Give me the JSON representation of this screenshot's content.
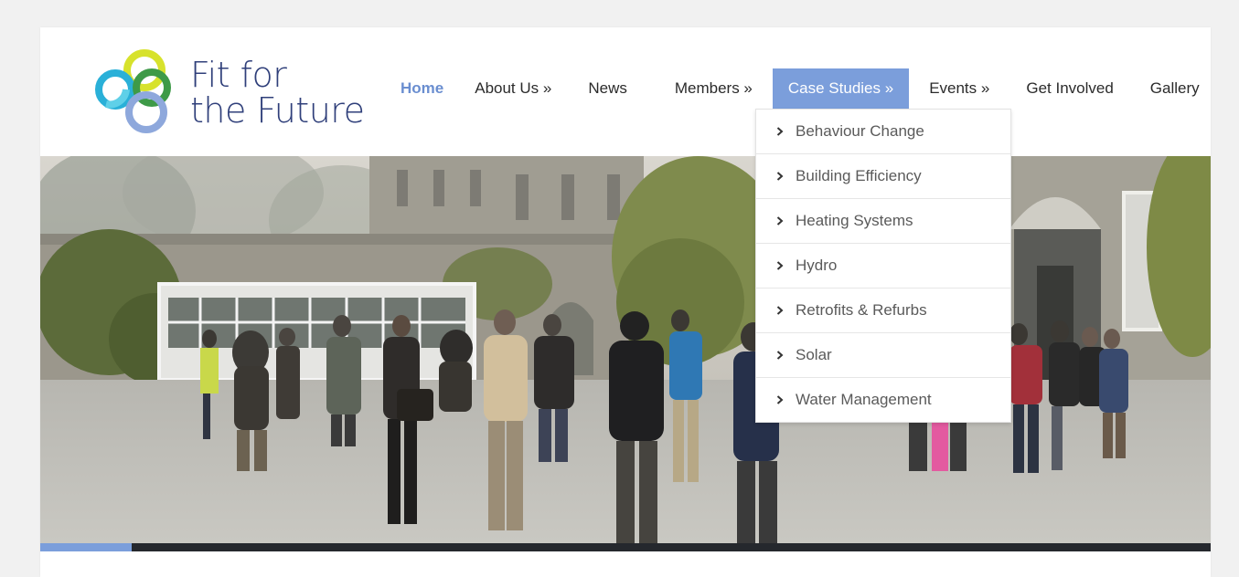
{
  "logo": {
    "line1": "Fit for",
    "line2": "the Future"
  },
  "nav": {
    "items": [
      {
        "label": "Home"
      },
      {
        "label": "About Us »"
      },
      {
        "label": "News"
      },
      {
        "label": "Members »"
      },
      {
        "label": "Case Studies »"
      },
      {
        "label": "Events »"
      },
      {
        "label": "Get Involved"
      },
      {
        "label": "Gallery"
      }
    ]
  },
  "dropdown": {
    "items": [
      {
        "label": "Behaviour Change"
      },
      {
        "label": "Building Efficiency"
      },
      {
        "label": "Heating Systems"
      },
      {
        "label": "Hydro"
      },
      {
        "label": "Retrofits & Refurbs"
      },
      {
        "label": "Solar"
      },
      {
        "label": "Water Management"
      }
    ]
  },
  "slider": {
    "progress": 0.078
  },
  "colors": {
    "accent": "#7b9edb",
    "home_link": "#6a8ed0",
    "logo_text": "#2f3f7a",
    "bar": "#25282d"
  }
}
